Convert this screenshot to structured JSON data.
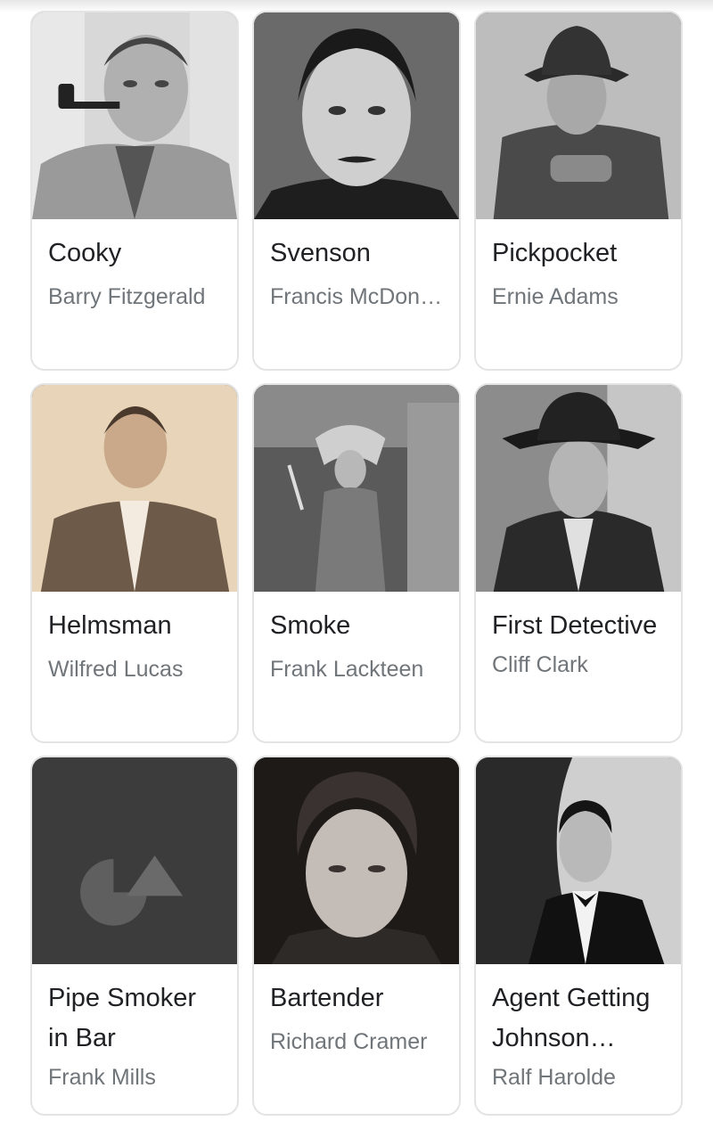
{
  "cast": [
    {
      "role": "Cooky",
      "actor": "Barry Fitzgerald",
      "photo": "man-with-pipe-photo"
    },
    {
      "role": "Svenson",
      "actor": "Francis McDon…",
      "photo": "man-with-mustache-photo"
    },
    {
      "role": "Pickpocket",
      "actor": "Ernie Adams",
      "photo": "man-in-fedora-photo"
    },
    {
      "role": "Helmsman",
      "actor": "Wilfred Lucas",
      "photo": "sepia-portrait-photo"
    },
    {
      "role": "Smoke",
      "actor": "Frank Lackteen",
      "photo": "tribal-costume-photo"
    },
    {
      "role": "First Detective",
      "actor": "Cliff Clark",
      "photo": "detective-in-hat-photo"
    },
    {
      "role": "Pipe Smoker in Bar",
      "actor": "Frank Mills",
      "photo": "image-placeholder-icon"
    },
    {
      "role": "Bartender",
      "actor": "Richard Cramer",
      "photo": "stern-man-photo"
    },
    {
      "role": "Agent Getting Johnson…",
      "actor": "Ralf Harolde",
      "photo": "man-in-tuxedo-photo"
    }
  ]
}
